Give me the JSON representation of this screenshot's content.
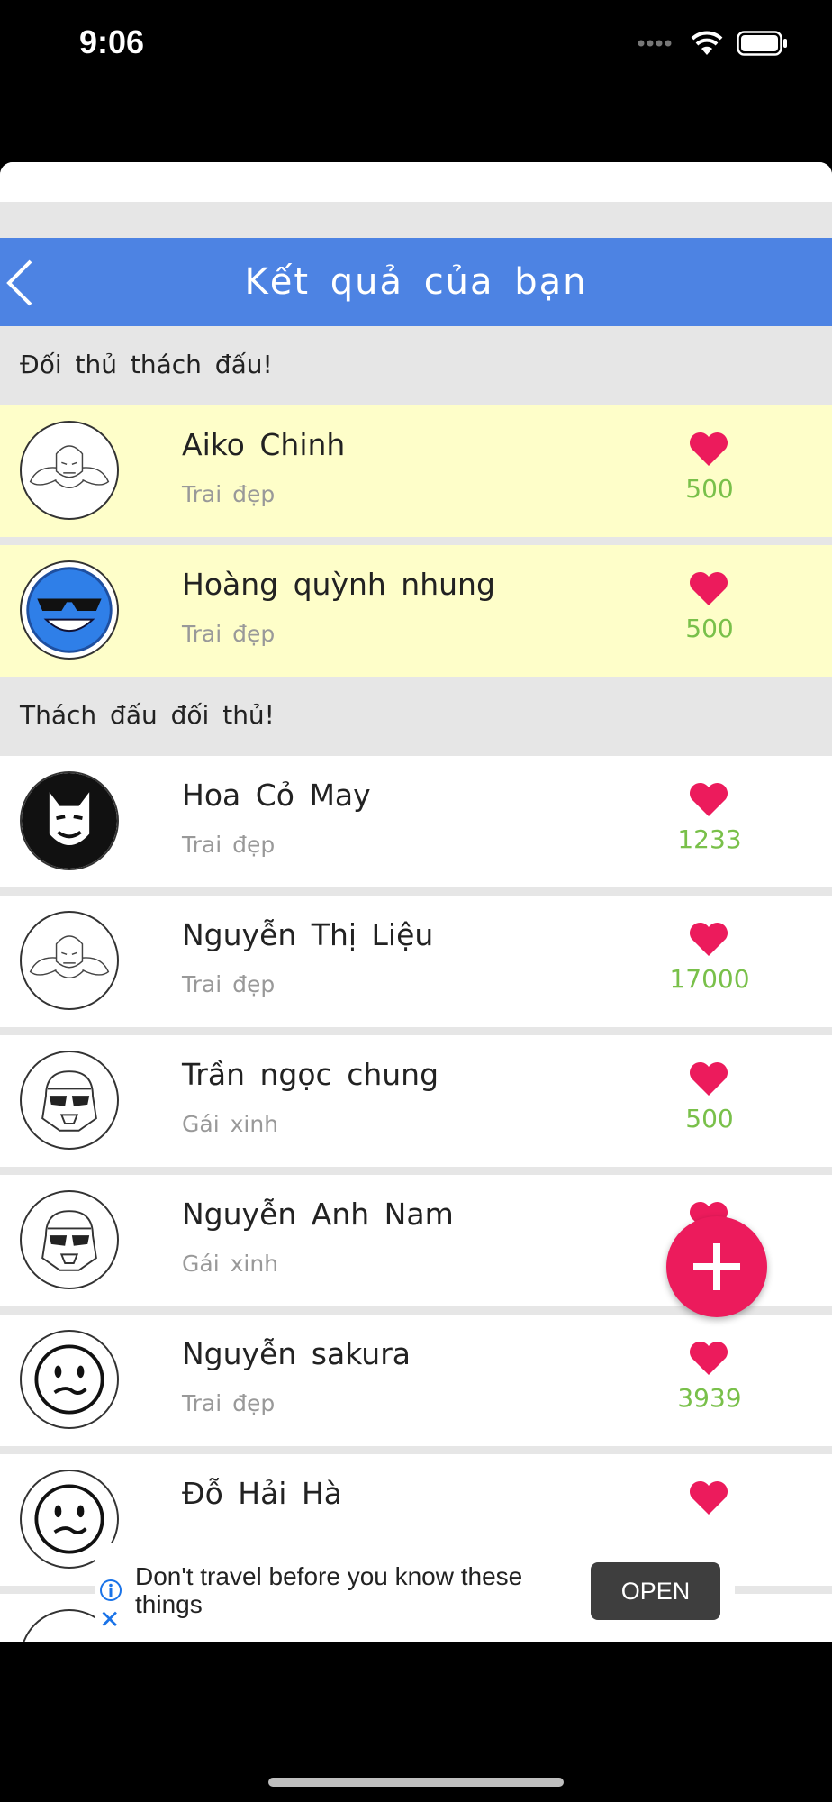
{
  "status_bar": {
    "time": "9:06"
  },
  "header": {
    "title": "Kết quả của bạn"
  },
  "sections": [
    {
      "title": "Đối thủ thách đấu!"
    },
    {
      "title": "Thách đấu đối thủ!"
    }
  ],
  "challengers": [
    {
      "name": "Aiko Chinh",
      "subtitle": "Trai đẹp",
      "score": "500",
      "avatar": "hulk-avatar"
    },
    {
      "name": "Hoàng quỳnh nhung",
      "subtitle": "Trai đẹp",
      "score": "500",
      "avatar": "blue-sunglasses-smiley-avatar"
    }
  ],
  "opponents": [
    {
      "name": "Hoa Cỏ May",
      "subtitle": "Trai đẹp",
      "score": "1233",
      "avatar": "mask-avatar"
    },
    {
      "name": "Nguyễn Thị Liệu",
      "subtitle": "Trai đẹp",
      "score": "17000",
      "avatar": "hulk-avatar"
    },
    {
      "name": "Trần ngọc chung",
      "subtitle": "Gái xinh",
      "score": "500",
      "avatar": "stormtrooper-avatar"
    },
    {
      "name": "Nguyễn Anh Nam",
      "subtitle": "Gái xinh",
      "score": "",
      "avatar": "stormtrooper-avatar"
    },
    {
      "name": "Nguyễn sakura",
      "subtitle": "Trai đẹp",
      "score": "3939",
      "avatar": "smiley-avatar"
    },
    {
      "name": "Đỗ Hải Hà",
      "subtitle": "",
      "score": "",
      "avatar": "smiley-avatar"
    }
  ],
  "ad": {
    "text": "Don't travel before you know these things",
    "button": "OPEN"
  },
  "colors": {
    "header": "#4d83e3",
    "highlight_row": "#fefec9",
    "heart": "#ec1b5c",
    "score": "#79c04a",
    "fab": "#ec1b5c"
  }
}
